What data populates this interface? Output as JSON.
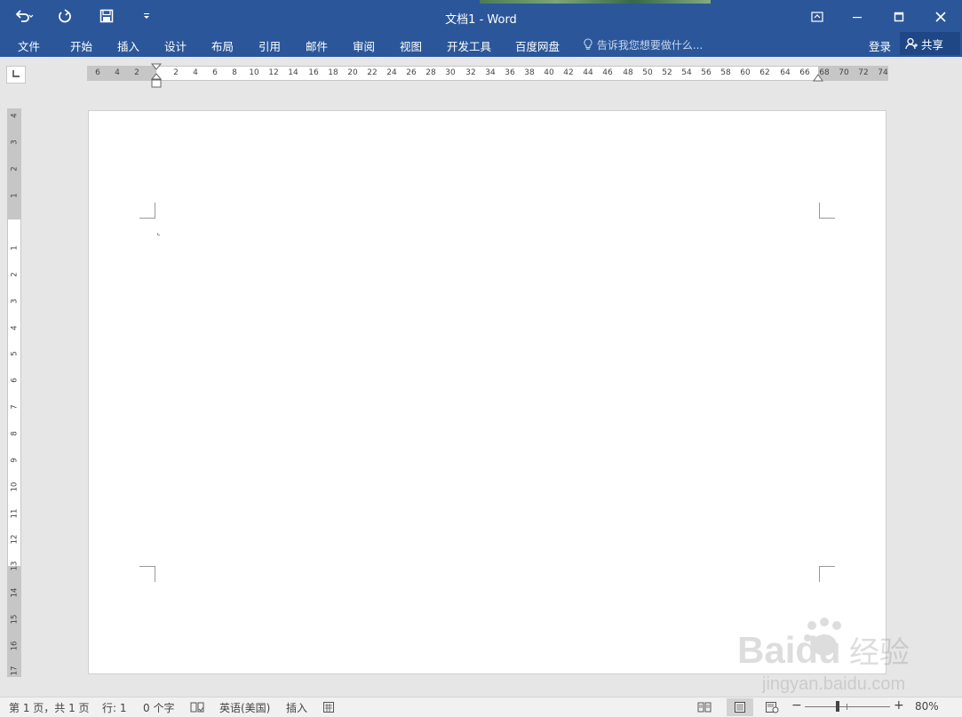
{
  "window": {
    "title": "文档1 - Word",
    "accent_color": "#2b579a"
  },
  "quick_access": {
    "icons": [
      "undo-icon",
      "redo-icon",
      "save-icon",
      "customize-dropdown-icon"
    ]
  },
  "menu": {
    "tabs": [
      "文件",
      "开始",
      "插入",
      "设计",
      "布局",
      "引用",
      "邮件",
      "审阅",
      "视图",
      "开发工具",
      "百度网盘"
    ],
    "tell_me_placeholder": "告诉我您想要做什么...",
    "login_label": "登录",
    "share_label": "共享"
  },
  "horizontal_ruler": {
    "left_labels": [
      "6",
      "4",
      "2"
    ],
    "labels": [
      "2",
      "4",
      "6",
      "8",
      "10",
      "12",
      "14",
      "16",
      "18",
      "20",
      "22",
      "24",
      "26",
      "28",
      "30",
      "32",
      "34",
      "36",
      "38",
      "40",
      "42",
      "44",
      "46",
      "48",
      "50",
      "52",
      "54",
      "56",
      "58",
      "60",
      "62",
      "64",
      "66",
      "68",
      "70",
      "72",
      "74"
    ]
  },
  "vertical_ruler": {
    "top_labels": [
      "4",
      "3",
      "2",
      "1"
    ],
    "labels": [
      "1",
      "2",
      "3",
      "4",
      "5",
      "6",
      "7",
      "8",
      "9",
      "10",
      "11",
      "12",
      "13",
      "14",
      "15",
      "16",
      "17"
    ]
  },
  "status": {
    "page_info": "第 1 页，共 1 页",
    "line_info": "行: 1",
    "word_count": "0 个字",
    "language": "英语(美国)",
    "mode": "插入",
    "zoom": "80%",
    "zoom_level_percent": 80
  },
  "watermark": {
    "brand": "Baidu",
    "chinese": "经验",
    "url": "jingyan.baidu.com"
  }
}
